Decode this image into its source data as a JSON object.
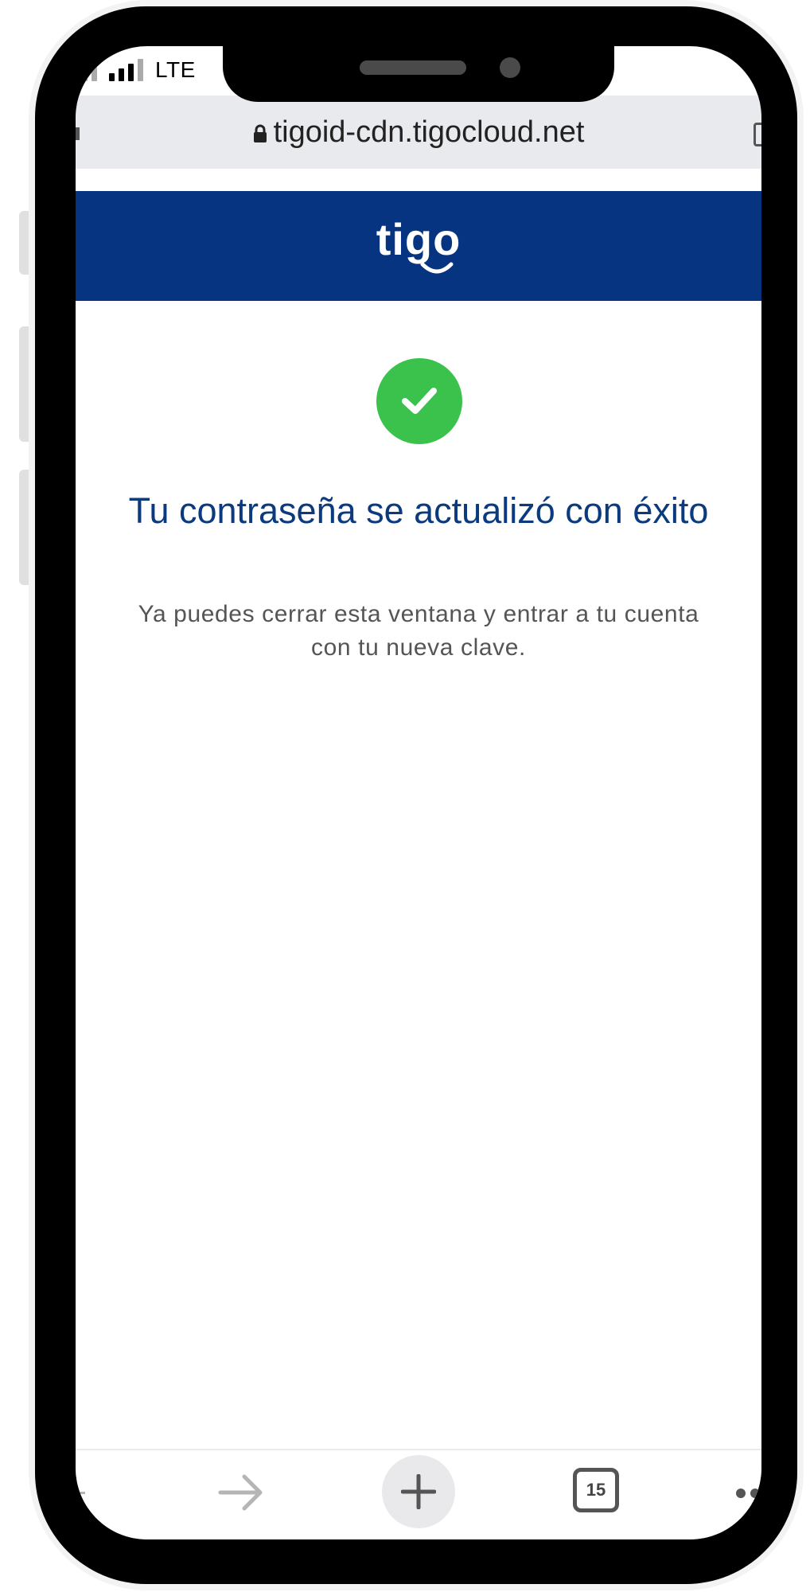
{
  "status_bar": {
    "network": "LTE"
  },
  "browser": {
    "url": "tigoid-cdn.tigocloud.net",
    "tab_count": "15"
  },
  "header": {
    "logo_text": "tigo",
    "background_color": "#063480"
  },
  "content": {
    "status_icon": "check-icon",
    "title": "Tu contraseña se actualizó con éxito",
    "message": "Ya puedes cerrar esta ventana y entrar a tu cuenta con tu nueva clave.",
    "success_color": "#3ac24d"
  },
  "toolbar": {
    "icons": [
      "back-icon",
      "forward-icon",
      "plus-icon",
      "tabs-icon",
      "more-icon"
    ]
  }
}
